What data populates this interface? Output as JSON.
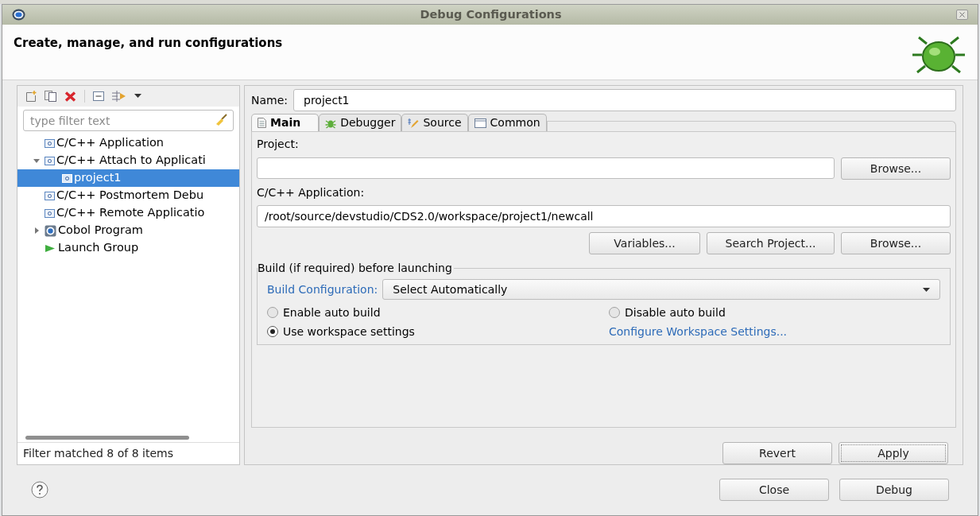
{
  "window": {
    "title": "Debug Configurations"
  },
  "header": {
    "title": "Create, manage, and run configurations"
  },
  "filter": {
    "placeholder": "type filter text"
  },
  "tree": [
    {
      "label": "C/C++ Application",
      "kind": "c",
      "selected": false
    },
    {
      "label": "C/C++ Attach to Applicati",
      "kind": "c",
      "selected": false,
      "expanded": true,
      "children": [
        {
          "label": "project1",
          "kind": "c",
          "selected": true
        }
      ]
    },
    {
      "label": "C/C++ Postmortem Debu",
      "kind": "c",
      "selected": false
    },
    {
      "label": "C/C++ Remote Applicatio",
      "kind": "c",
      "selected": false
    },
    {
      "label": "Cobol Program",
      "kind": "cobol",
      "selected": false,
      "expanded": false
    },
    {
      "label": "Launch Group",
      "kind": "launch",
      "selected": false
    }
  ],
  "filter_status": "Filter matched 8 of 8 items",
  "name": {
    "label": "Name:",
    "value": "project1"
  },
  "tabs": [
    {
      "label": "Main",
      "kind": "main",
      "selected": true
    },
    {
      "label": "Debugger",
      "kind": "debugger",
      "selected": false
    },
    {
      "label": "Source",
      "kind": "source",
      "selected": false
    },
    {
      "label": "Common",
      "kind": "common",
      "selected": false
    }
  ],
  "project": {
    "label": "Project:",
    "button": "Browse..."
  },
  "application": {
    "label": "C/C++ Application:",
    "value": "/root/source/devstudio/CDS2.0/workspace/project1/newcall",
    "buttons": [
      "Variables...",
      "Search Project...",
      "Browse..."
    ]
  },
  "build": {
    "title": "Build (if required) before launching",
    "config_label": "Build Configuration:",
    "config_value": "Select Automatically",
    "options": [
      {
        "kind": "radio",
        "label": "Enable auto build",
        "selected": false
      },
      {
        "kind": "radio",
        "label": "Disable auto build",
        "selected": false
      },
      {
        "kind": "radio",
        "label": "Use workspace settings",
        "selected": true
      },
      {
        "kind": "link",
        "label": "Configure Workspace Settings..."
      }
    ]
  },
  "panel_buttons": [
    "Revert",
    "Apply"
  ],
  "dialog_buttons": [
    "Close",
    "Debug"
  ]
}
